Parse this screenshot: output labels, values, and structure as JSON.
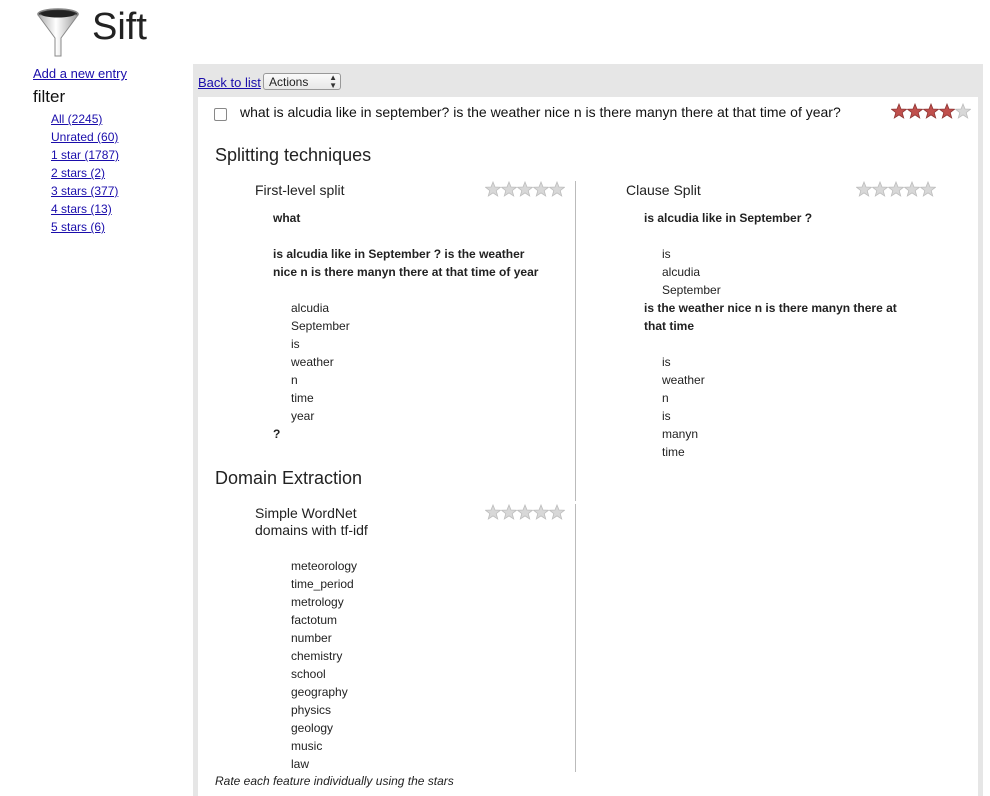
{
  "app": {
    "title": "Sift"
  },
  "sidebar": {
    "add_entry": "Add a new entry",
    "filter_title": "filter",
    "filters": [
      "All (2245)",
      "Unrated (60)",
      "1 star (1787)",
      "2 stars (2)",
      "3 stars (377)",
      "4 stars (13)",
      "5 stars (6)"
    ]
  },
  "toolbar": {
    "back": "Back to list",
    "actions": "Actions"
  },
  "entry": {
    "text": "what is alcudia like in september? is the weather nice n is there manyn there at that time of year?",
    "rating": 4,
    "max_rating": 5
  },
  "colors": {
    "star_filled": "#c0504d",
    "star_empty": "#d8d8d8",
    "link": "#1a0dab"
  },
  "sections": [
    {
      "title": "Splitting techniques",
      "features": [
        {
          "title": "First-level split",
          "rating": 0,
          "lines": [
            {
              "text": "what",
              "bold": true,
              "indent": 0
            },
            {
              "text": "",
              "bold": false,
              "indent": 0
            },
            {
              "text": "is alcudia like in September ? is the weather",
              "bold": true,
              "indent": 0
            },
            {
              "text": "nice n is there manyn there at that time of year",
              "bold": true,
              "indent": 0
            },
            {
              "text": "",
              "bold": false,
              "indent": 0
            },
            {
              "text": "alcudia",
              "bold": false,
              "indent": 1
            },
            {
              "text": "September",
              "bold": false,
              "indent": 1
            },
            {
              "text": "is",
              "bold": false,
              "indent": 1
            },
            {
              "text": "weather",
              "bold": false,
              "indent": 1
            },
            {
              "text": "n",
              "bold": false,
              "indent": 1
            },
            {
              "text": "time",
              "bold": false,
              "indent": 1
            },
            {
              "text": "year",
              "bold": false,
              "indent": 1
            },
            {
              "text": "?",
              "bold": true,
              "indent": 0
            }
          ]
        },
        {
          "title": "Clause Split",
          "rating": 0,
          "lines": [
            {
              "text": "is alcudia like in September ?",
              "bold": true,
              "indent": 0
            },
            {
              "text": "",
              "bold": false,
              "indent": 0
            },
            {
              "text": "is",
              "bold": false,
              "indent": 1
            },
            {
              "text": "alcudia",
              "bold": false,
              "indent": 1
            },
            {
              "text": "September",
              "bold": false,
              "indent": 1
            },
            {
              "text": "is the weather nice n is there manyn there at",
              "bold": true,
              "indent": 0
            },
            {
              "text": "that time",
              "bold": true,
              "indent": 0
            },
            {
              "text": "",
              "bold": false,
              "indent": 0
            },
            {
              "text": "is",
              "bold": false,
              "indent": 1
            },
            {
              "text": "weather",
              "bold": false,
              "indent": 1
            },
            {
              "text": "n",
              "bold": false,
              "indent": 1
            },
            {
              "text": "is",
              "bold": false,
              "indent": 1
            },
            {
              "text": "manyn",
              "bold": false,
              "indent": 1
            },
            {
              "text": "time",
              "bold": false,
              "indent": 1
            }
          ]
        }
      ]
    },
    {
      "title": "Domain Extraction",
      "features": [
        {
          "title": "Simple WordNet\ndomains with tf-idf",
          "rating": 0,
          "lines": [
            {
              "text": "meteorology",
              "bold": false,
              "indent": 1
            },
            {
              "text": "time_period",
              "bold": false,
              "indent": 1
            },
            {
              "text": "metrology",
              "bold": false,
              "indent": 1
            },
            {
              "text": "factotum",
              "bold": false,
              "indent": 1
            },
            {
              "text": "number",
              "bold": false,
              "indent": 1
            },
            {
              "text": "chemistry",
              "bold": false,
              "indent": 1
            },
            {
              "text": "school",
              "bold": false,
              "indent": 1
            },
            {
              "text": "geography",
              "bold": false,
              "indent": 1
            },
            {
              "text": "physics",
              "bold": false,
              "indent": 1
            },
            {
              "text": "geology",
              "bold": false,
              "indent": 1
            },
            {
              "text": "music",
              "bold": false,
              "indent": 1
            },
            {
              "text": "law",
              "bold": false,
              "indent": 1
            }
          ]
        }
      ]
    }
  ],
  "footer_note": "Rate each feature individually using the stars"
}
